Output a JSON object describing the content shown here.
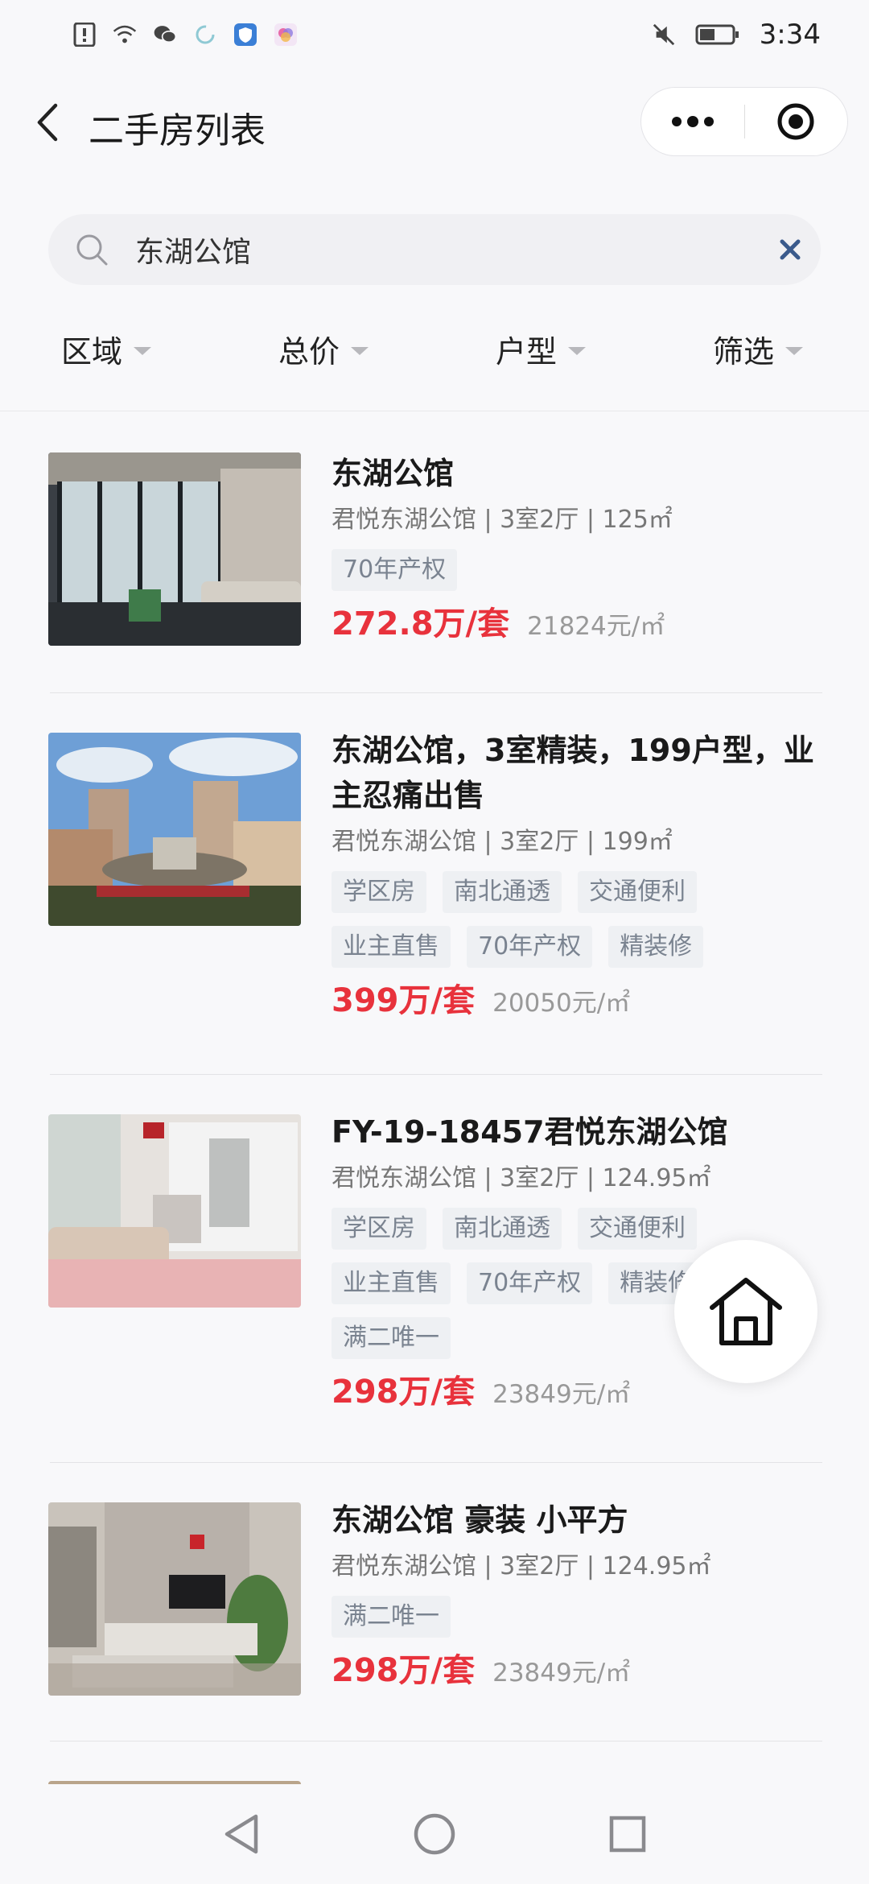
{
  "status_bar": {
    "time": "3:34",
    "icons": [
      "alert-icon",
      "wifi-icon",
      "wechat-icon",
      "loading-icon",
      "shield-app-icon",
      "colorful-app-icon",
      "mute-icon",
      "battery-icon"
    ]
  },
  "nav": {
    "title": "二手房列表"
  },
  "search": {
    "value": "东湖公馆"
  },
  "filters": [
    {
      "label": "区域"
    },
    {
      "label": "总价"
    },
    {
      "label": "户型"
    },
    {
      "label": "筛选"
    }
  ],
  "listings": [
    {
      "title": "东湖公馆",
      "subtitle": "君悦东湖公馆 | 3室2厅 | 125㎡",
      "tags": [
        "70年产权"
      ],
      "price": "272.8万/套",
      "unit_price": "21824元/㎡"
    },
    {
      "title": "东湖公馆，3室精装，199户型，业主忍痛出售",
      "subtitle": "君悦东湖公馆 | 3室2厅 | 199㎡",
      "tags": [
        "学区房",
        "南北通透",
        "交通便利",
        "业主直售",
        "70年产权",
        "精装修"
      ],
      "price": "399万/套",
      "unit_price": "20050元/㎡"
    },
    {
      "title": "FY-19-18457君悦东湖公馆",
      "subtitle": "君悦东湖公馆 | 3室2厅 | 124.95㎡",
      "tags": [
        "学区房",
        "南北通透",
        "交通便利",
        "业主直售",
        "70年产权",
        "精装修",
        "满二唯一"
      ],
      "price": "298万/套",
      "unit_price": "23849元/㎡"
    },
    {
      "title": "东湖公馆 豪装 小平方",
      "subtitle": "君悦东湖公馆 | 3室2厅 | 124.95㎡",
      "tags": [
        "满二唯一"
      ],
      "price": "298万/套",
      "unit_price": "23849元/㎡"
    }
  ],
  "colors": {
    "price": "#e8323c",
    "tag_bg": "#eef0f3",
    "tag_text": "#7a8390",
    "clear_icon": "#3a5a8c"
  }
}
